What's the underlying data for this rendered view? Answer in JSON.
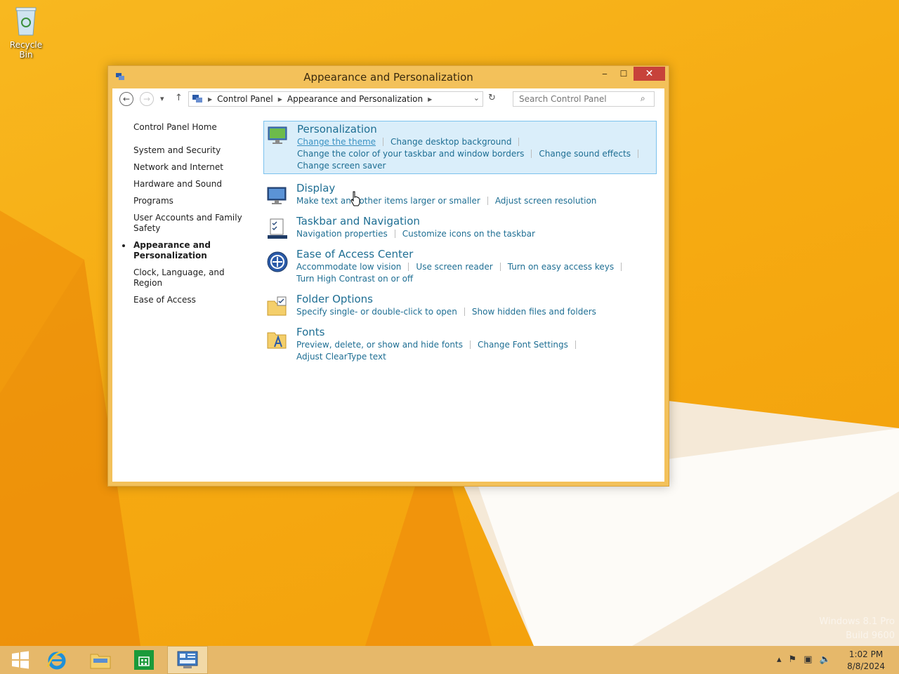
{
  "desktop": {
    "recycle_bin_label": "Recycle Bin",
    "watermark_line1": "Windows 8.1 Pro",
    "watermark_line2": "Build 9600"
  },
  "window": {
    "title": "Appearance and Personalization",
    "buttons": {
      "minimize": "‒",
      "maximize": "☐",
      "close": "✕"
    }
  },
  "toolbar": {
    "back": "←",
    "forward": "→",
    "recent": "▾",
    "up": "↑",
    "breadcrumb": [
      "Control Panel",
      "Appearance and Personalization"
    ],
    "refresh": "↻",
    "search_placeholder": "Search Control Panel"
  },
  "sidebar": {
    "home": "Control Panel Home",
    "items": [
      "System and Security",
      "Network and Internet",
      "Hardware and Sound",
      "Programs",
      "User Accounts and Family Safety",
      "Appearance and Personalization",
      "Clock, Language, and Region",
      "Ease of Access"
    ],
    "active_index": 5
  },
  "categories": {
    "personalization": {
      "title": "Personalization",
      "links": [
        "Change the theme",
        "Change desktop background",
        "Change the color of your taskbar and window borders",
        "Change sound effects",
        "Change screen saver"
      ]
    },
    "display": {
      "title": "Display",
      "links": [
        "Make text and other items larger or smaller",
        "Adjust screen resolution"
      ]
    },
    "taskbar": {
      "title": "Taskbar and Navigation",
      "links": [
        "Navigation properties",
        "Customize icons on the taskbar"
      ]
    },
    "ease": {
      "title": "Ease of Access Center",
      "links": [
        "Accommodate low vision",
        "Use screen reader",
        "Turn on easy access keys",
        "Turn High Contrast on or off"
      ]
    },
    "folder": {
      "title": "Folder Options",
      "links": [
        "Specify single- or double-click to open",
        "Show hidden files and folders"
      ]
    },
    "fonts": {
      "title": "Fonts",
      "links": [
        "Preview, delete, or show and hide fonts",
        "Change Font Settings",
        "Adjust ClearType text"
      ]
    }
  },
  "taskbar": {
    "time": "1:02 PM",
    "date": "8/8/2024",
    "apps": [
      "start-button",
      "internet-explorer",
      "file-explorer",
      "store",
      "control-panel"
    ]
  },
  "colors": {
    "accent": "#1e6e93",
    "highlight_bg": "#daeefa",
    "window_frame": "#f3c15a",
    "close": "#c7423a"
  }
}
